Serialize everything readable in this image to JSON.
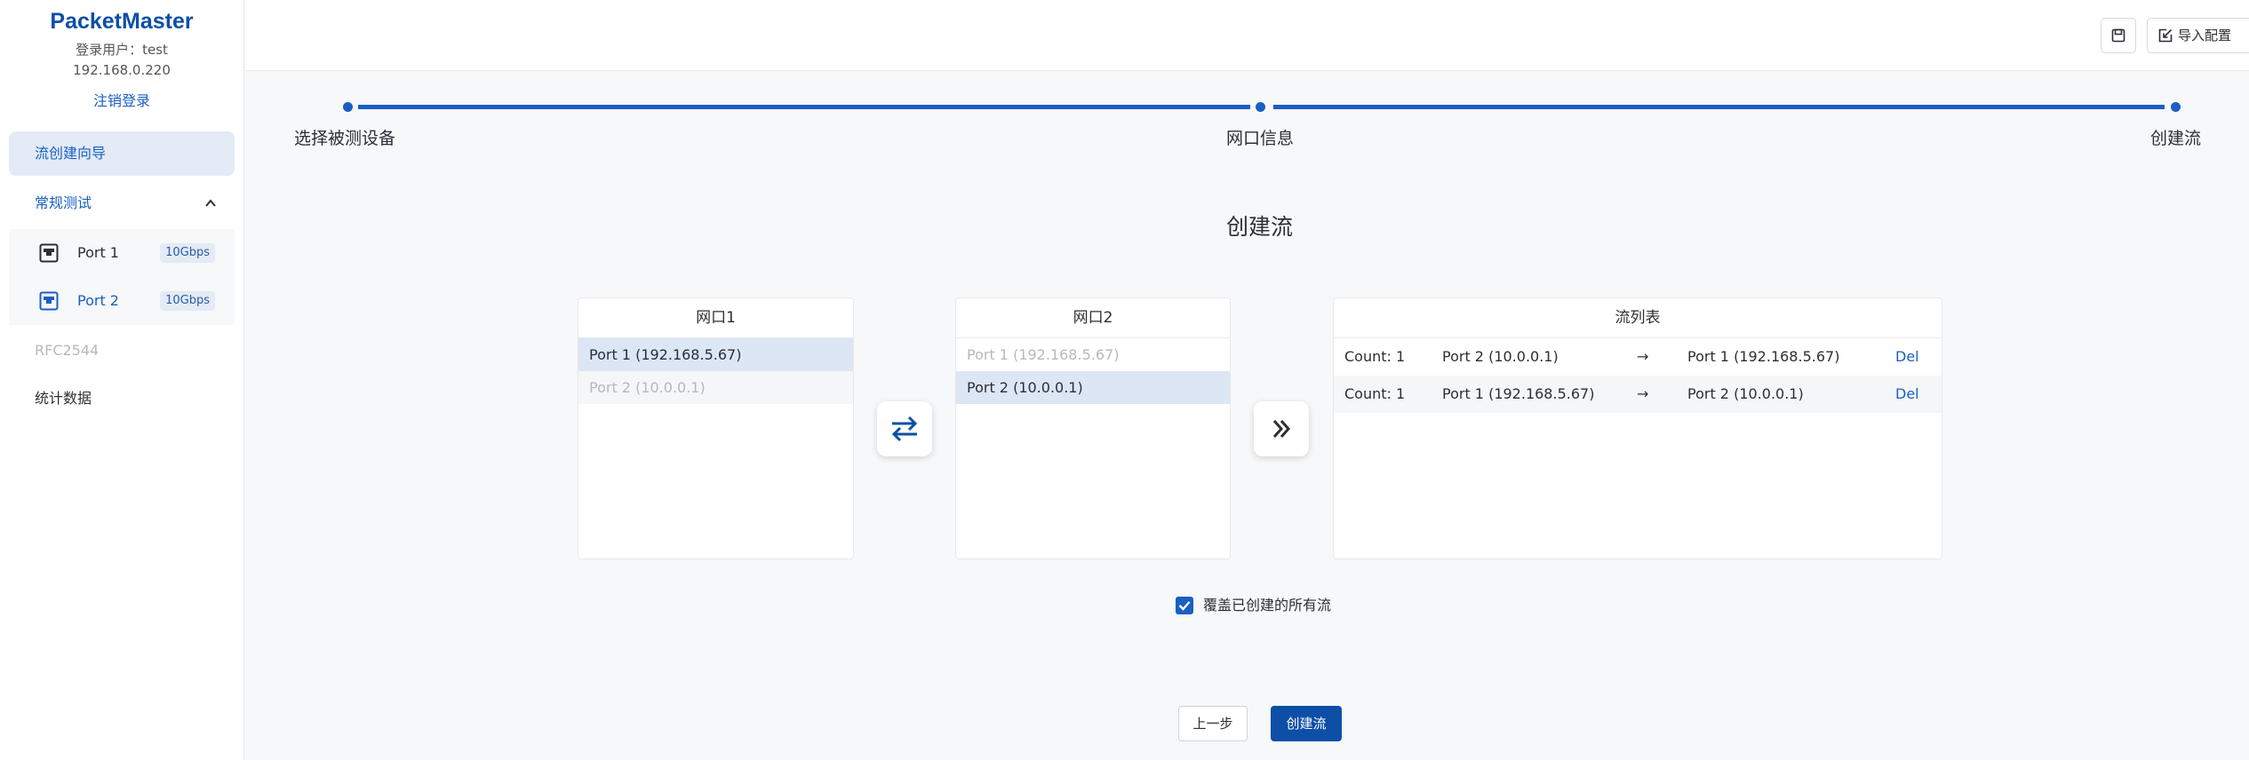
{
  "sidebar": {
    "brand": "PacketMaster",
    "user_line": "登录用户：test",
    "ip": "192.168.0.220",
    "logout": "注销登录",
    "nav": {
      "wizard": "流创建向导",
      "regular": "常规测试",
      "rfc": "RFC2544",
      "stats": "统计数据"
    },
    "ports": [
      {
        "label": "Port 1",
        "speed": "10Gbps"
      },
      {
        "label": "Port 2",
        "speed": "10Gbps"
      }
    ]
  },
  "header": {
    "import_label": "导入配置"
  },
  "steps": [
    "选择被测设备",
    "网口信息",
    "创建流"
  ],
  "page_title": "创建流",
  "panel1": {
    "title": "网口1",
    "rows": [
      "Port 1 (192.168.5.67)",
      "Port 2 (10.0.0.1)"
    ]
  },
  "panel2": {
    "title": "网口2",
    "rows": [
      "Port 1 (192.168.5.67)",
      "Port 2 (10.0.0.1)"
    ]
  },
  "flows": {
    "title": "流列表",
    "rows": [
      {
        "count_label": "Count:",
        "count": "1",
        "src": "Port 2 (10.0.0.1)",
        "arrow": "→",
        "dst": "Port 1 (192.168.5.67)",
        "action": "Del"
      },
      {
        "count_label": "Count:",
        "count": "1",
        "src": "Port 1 (192.168.5.67)",
        "arrow": "→",
        "dst": "Port 2 (10.0.0.1)",
        "action": "Del"
      }
    ]
  },
  "overwrite": {
    "label": "覆盖已创建的所有流",
    "checked": true
  },
  "buttons": {
    "prev": "上一步",
    "create": "创建流"
  },
  "colors": {
    "accent": "#1a5fc4",
    "brand": "#0d4fa6"
  }
}
